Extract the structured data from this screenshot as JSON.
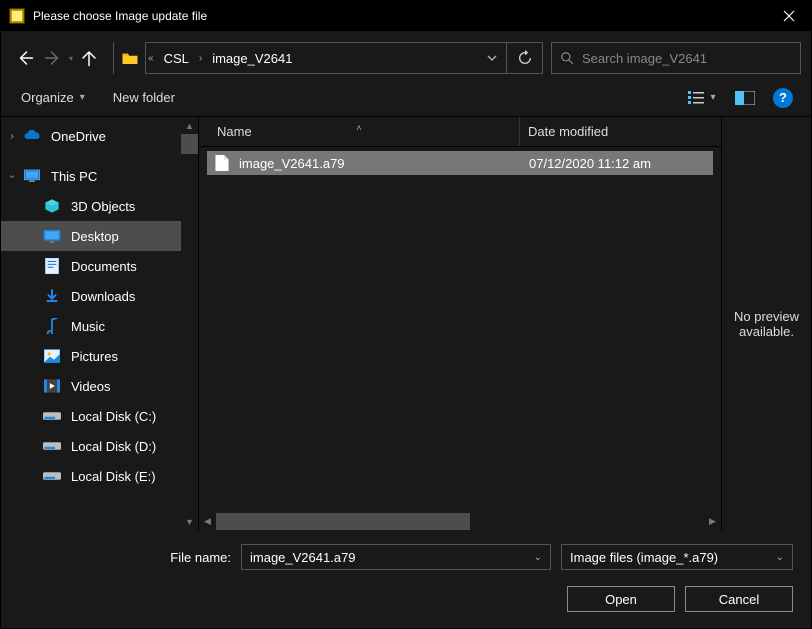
{
  "titlebar": {
    "title": "Please choose Image update file"
  },
  "breadcrumb": {
    "seg1": "CSL",
    "seg2": "image_V2641"
  },
  "search": {
    "placeholder": "Search image_V2641"
  },
  "toolbar": {
    "organize": "Organize",
    "newfolder": "New folder"
  },
  "columns": {
    "name": "Name",
    "date": "Date modified"
  },
  "sidebar": {
    "items": [
      {
        "label": "OneDrive"
      },
      {
        "label": "This PC"
      },
      {
        "label": "3D Objects"
      },
      {
        "label": "Desktop"
      },
      {
        "label": "Documents"
      },
      {
        "label": "Downloads"
      },
      {
        "label": "Music"
      },
      {
        "label": "Pictures"
      },
      {
        "label": "Videos"
      },
      {
        "label": "Local Disk (C:)"
      },
      {
        "label": "Local Disk (D:)"
      },
      {
        "label": "Local Disk (E:)"
      }
    ]
  },
  "files": [
    {
      "name": "image_V2641.a79",
      "date": "07/12/2020 11:12 am"
    }
  ],
  "preview": {
    "text": "No preview available."
  },
  "footer": {
    "filename_label": "File name:",
    "filename_value": "image_V2641.a79",
    "filter": "Image files (image_*.a79)",
    "open": "Open",
    "cancel": "Cancel"
  }
}
